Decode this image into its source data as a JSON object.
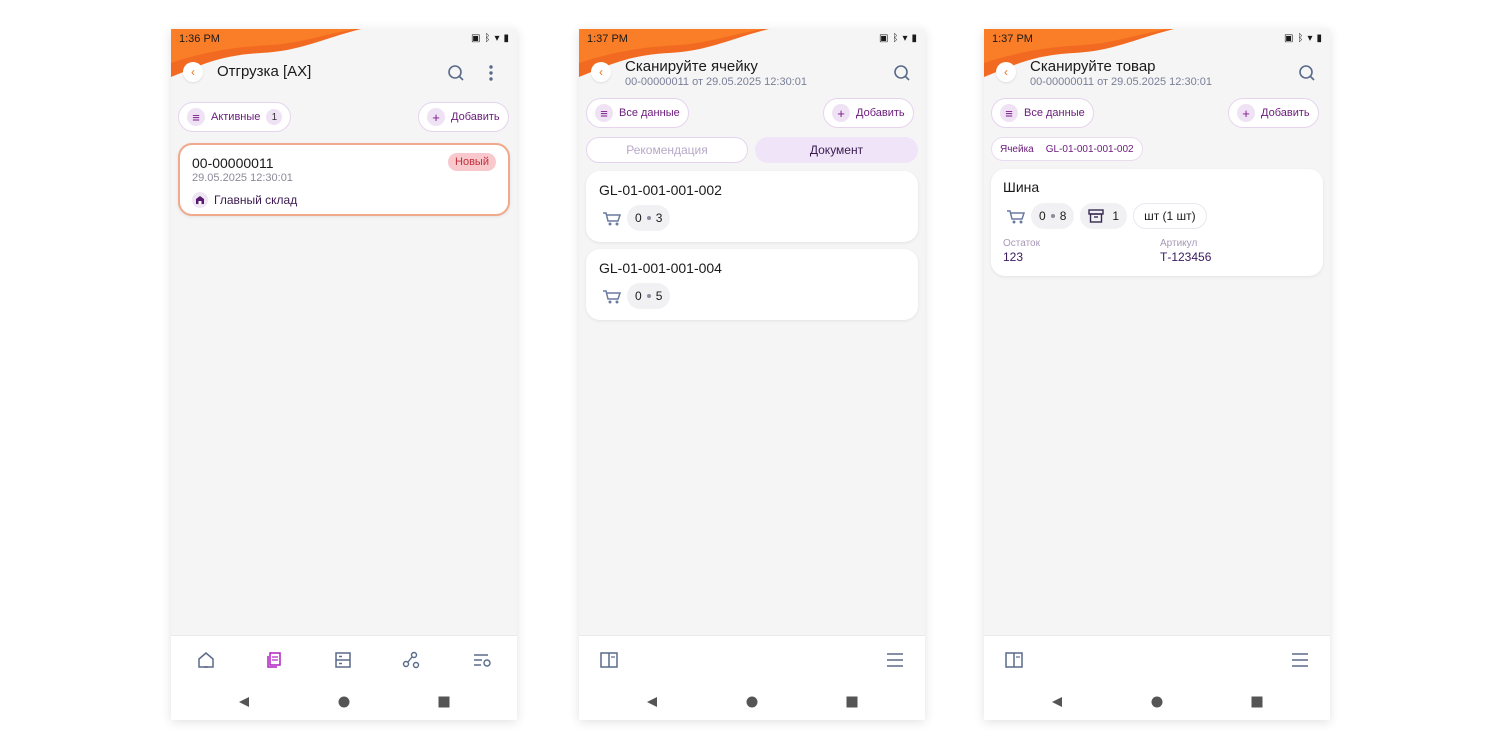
{
  "colors": {
    "accent": "#e8731f",
    "brand": "#7a1a8a",
    "status_new_bg": "#f8c8cc",
    "status_new_text": "#c0303a"
  },
  "screen1": {
    "time": "1:36 PM",
    "title": "Отгрузка [AX]",
    "filter_label": "Активные",
    "filter_count": "1",
    "add_label": "Добавить",
    "document": {
      "number": "00-00000011",
      "date": "29.05.2025 12:30:01",
      "status": "Новый",
      "warehouse": "Главный склад"
    },
    "nav_icons": [
      "home-icon",
      "documents-icon",
      "storage-icon",
      "share-icon",
      "settings-list-icon"
    ]
  },
  "screen2": {
    "time": "1:37 PM",
    "title": "Сканируйте ячейку",
    "subtitle": "00-00000011 от 29.05.2025 12:30:01",
    "filter_label": "Все данные",
    "add_label": "Добавить",
    "tabs": [
      "Рекомендация",
      "Документ"
    ],
    "active_tab": "Документ",
    "cells": [
      {
        "code": "GL-01-001-001-002",
        "done": "0",
        "total": "3"
      },
      {
        "code": "GL-01-001-001-004",
        "done": "0",
        "total": "5"
      }
    ]
  },
  "screen3": {
    "time": "1:37 PM",
    "title": "Сканируйте товар",
    "subtitle": "00-00000011 от 29.05.2025 12:30:01",
    "filter_label": "Все данные",
    "add_label": "Добавить",
    "cell_label": "Ячейка",
    "cell_code": "GL-01-001-001-002",
    "item": {
      "name": "Шина",
      "done": "0",
      "total": "8",
      "box_count": "1",
      "unit": "шт (1 шт)",
      "stock_label": "Остаток",
      "stock_value": "123",
      "sku_label": "Артикул",
      "sku_value": "Т-123456"
    }
  }
}
